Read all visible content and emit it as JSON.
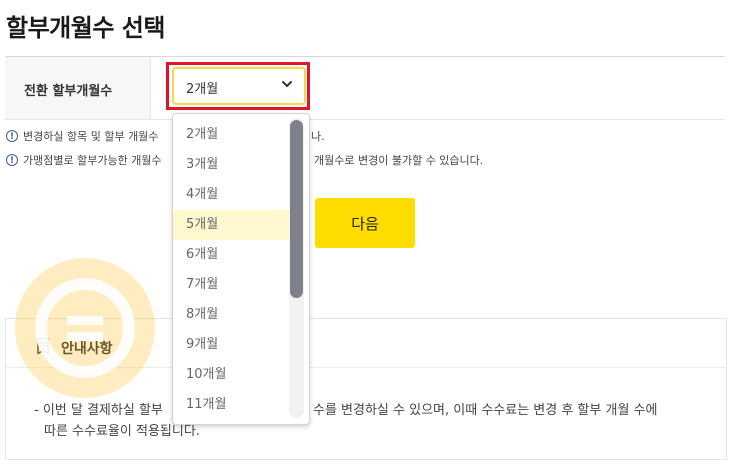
{
  "page": {
    "title": "할부개월수 선택"
  },
  "form": {
    "label": "전환 할부개월수",
    "select_value": "2개월",
    "highlight_color": "#e2132c",
    "select_border_color": "#f6d845"
  },
  "notices": [
    {
      "icon": "exclamation-icon",
      "text": "변경하실 항목 및 할부 개월수",
      "tail": "나."
    },
    {
      "icon": "exclamation-icon",
      "text": "가맹점별로 할부가능한 개월수",
      "tail": "개월수로 변경이 불가할 수 있습니다."
    }
  ],
  "buttons": {
    "next_label": "다음",
    "next_color": "#ffdd00"
  },
  "guide": {
    "title": "안내사항",
    "line1_left": "- 이번 달 결제하실 할부",
    "line1_right": "수를 변경하실 수 있으며, 이때 수수료는 변경 후 할부 개월 수에",
    "line2": "따른 수수료율이 적용됩니다."
  },
  "dropdown": {
    "options": [
      "2개월",
      "3개월",
      "4개월",
      "5개월",
      "6개월",
      "7개월",
      "8개월",
      "9개월",
      "10개월",
      "11개월"
    ],
    "highlighted": "5개월",
    "highlight_color": "#fff8cf"
  }
}
